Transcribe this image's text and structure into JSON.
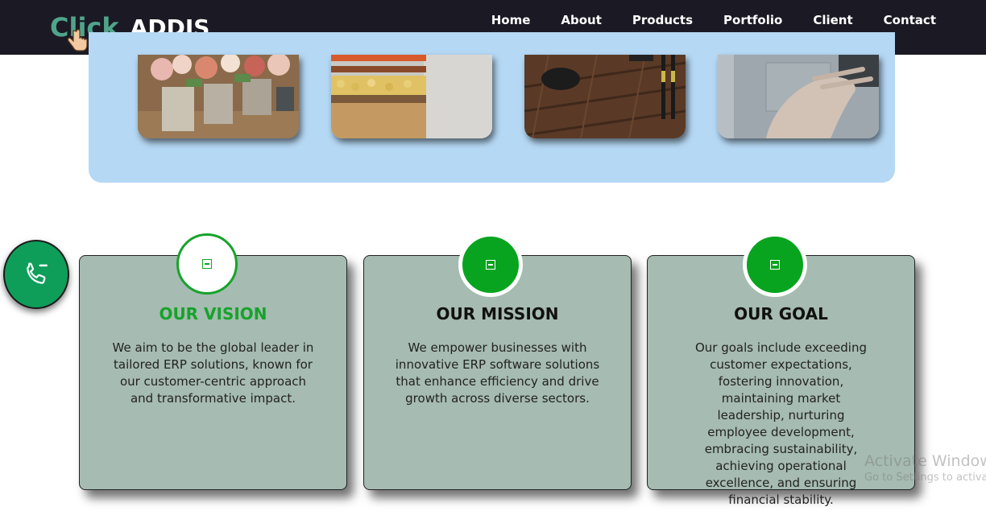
{
  "brand": {
    "logo_part1": "Click",
    "logo_part2": "ADDIS"
  },
  "nav": {
    "items": [
      {
        "label": "Home"
      },
      {
        "label": "About"
      },
      {
        "label": "Products"
      },
      {
        "label": "Portfolio"
      },
      {
        "label": "Client"
      },
      {
        "label": "Contact"
      }
    ]
  },
  "gallery": {
    "photos": [
      {
        "subject": "flower-stall-photo"
      },
      {
        "subject": "market-produce-photo"
      },
      {
        "subject": "gym-floor-photo"
      },
      {
        "subject": "laptop-typing-photo"
      }
    ]
  },
  "cards": [
    {
      "title": "OUR VISION",
      "text": "We aim to be the global leader in tailored ERP solutions, known for our customer-centric approach and transformative impact."
    },
    {
      "title": "OUR MISSION",
      "text": "We empower businesses with innovative ERP software solutions that enhance efficiency and drive growth across diverse sectors."
    },
    {
      "title": "OUR GOAL",
      "text": "Our goals include exceeding customer expectations, fostering innovation, maintaining market leadership, nurturing employee development, embracing sustainability, achieving operational excellence, and ensuring financial stability."
    }
  ],
  "watermark": {
    "line1": "Activate Windows",
    "line2": "Go to Settings to activate Windows."
  },
  "colors": {
    "accent": "#16a32a",
    "navbar": "#1b1a24",
    "card_bg": "#a6bbb1",
    "panel_bg": "#b5d8f4",
    "phone_button": "#0e9e5a"
  }
}
